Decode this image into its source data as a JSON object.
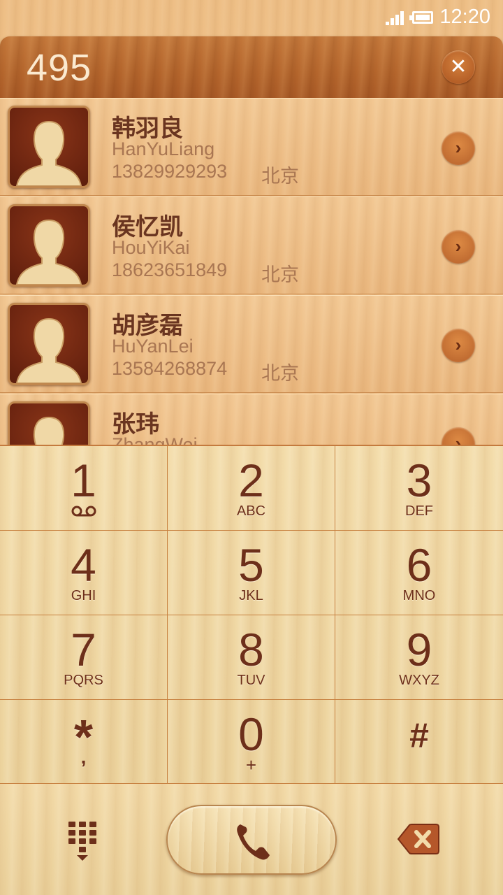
{
  "status_bar": {
    "time": "12:20"
  },
  "dialer": {
    "number": "495"
  },
  "contacts": [
    {
      "name": "韩羽良",
      "pinyin": "HanYuLiang",
      "phone": "13829929293",
      "location": "北京"
    },
    {
      "name": "侯忆凯",
      "pinyin": "HouYiKai",
      "phone": "18623651849",
      "location": "北京"
    },
    {
      "name": "胡彦磊",
      "pinyin": "HuYanLei",
      "phone": "13584268874",
      "location": "北京"
    },
    {
      "name": "张玮",
      "pinyin": "ZhangWei",
      "phone": "",
      "location": ""
    }
  ],
  "keypad": {
    "keys": [
      {
        "digit": "1",
        "letters": ""
      },
      {
        "digit": "2",
        "letters": "ABC"
      },
      {
        "digit": "3",
        "letters": "DEF"
      },
      {
        "digit": "4",
        "letters": "GHI"
      },
      {
        "digit": "5",
        "letters": "JKL"
      },
      {
        "digit": "6",
        "letters": "MNO"
      },
      {
        "digit": "7",
        "letters": "PQRS"
      },
      {
        "digit": "8",
        "letters": "TUV"
      },
      {
        "digit": "9",
        "letters": "WXYZ"
      },
      {
        "digit": "*",
        "letters": ","
      },
      {
        "digit": "0",
        "letters": "+"
      },
      {
        "digit": "#",
        "letters": ""
      }
    ]
  },
  "icons": {
    "clear": "close-icon",
    "detail": "chevron-right-icon",
    "voicemail": "voicemail-icon",
    "dialpad": "dialpad-icon",
    "call": "phone-icon",
    "delete": "backspace-icon"
  },
  "colors": {
    "wood_dark": "#b4652c",
    "text_brown": "#6d2f1a",
    "wood_light": "#f3dcaa"
  }
}
